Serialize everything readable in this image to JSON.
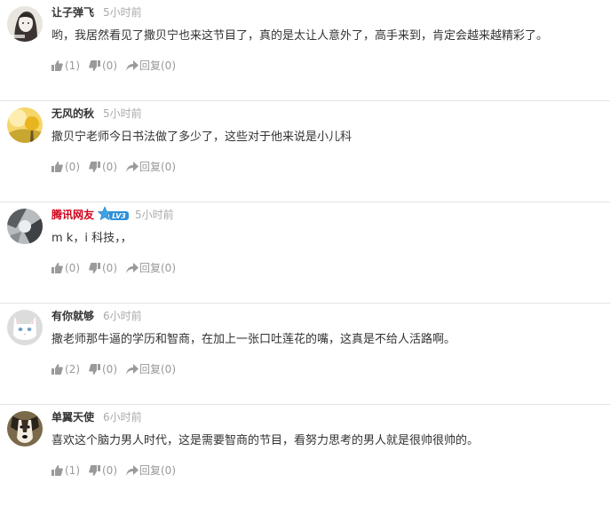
{
  "comments": [
    {
      "name": "让子弹飞",
      "time": "5小时前",
      "text": "哟，我居然看见了撒贝宁也来这节目了，真的是太让人意外了，高手来到，肯定会越来越精彩了。",
      "like": "(1)",
      "dislike": "(0)",
      "reply": "回复(0)",
      "avatar": "avatar-girl-sketch"
    },
    {
      "name": "无风的秋",
      "time": "5小时前",
      "text": "撒贝宁老师今日书法做了多少了，这些对于他来说是小儿科",
      "like": "(0)",
      "dislike": "(0)",
      "reply": "回复(0)",
      "avatar": "avatar-yellow-tree"
    },
    {
      "name": "腾讯网友",
      "time": "5小时前",
      "text": "m k，i 科技，，",
      "like": "(0)",
      "dislike": "(0)",
      "reply": "回复(0)",
      "avatar": "avatar-gray-abstract",
      "badge": "LV3"
    },
    {
      "name": "有你就够",
      "time": "6小时前",
      "text": "撒老师那牛逼的学历和智商，在加上一张口吐莲花的嘴，这真是不给人活路啊。",
      "like": "(2)",
      "dislike": "(0)",
      "reply": "回复(0)",
      "avatar": "avatar-white-cat"
    },
    {
      "name": "单翼天使",
      "time": "6小时前",
      "text": "喜欢这个脑力男人时代，这是需要智商的节目，看努力思考的男人就是很帅很帅的。",
      "like": "(1)",
      "dislike": "(0)",
      "reply": "回复(0)",
      "avatar": "avatar-dog"
    }
  ],
  "colors": {
    "name_vip": "#d0021b",
    "muted": "#999999",
    "divider": "#e3e3e3"
  }
}
